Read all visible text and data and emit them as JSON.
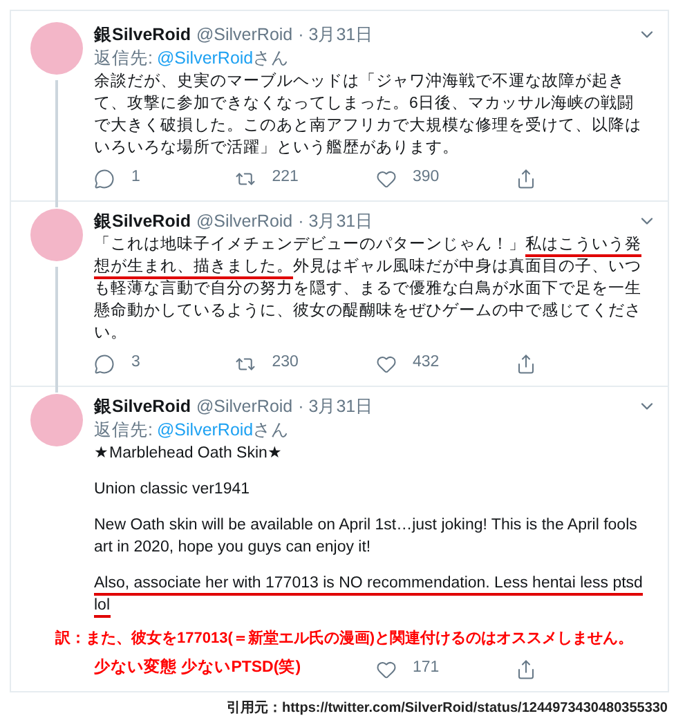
{
  "tweets": [
    {
      "author_name": "銀SilveRoid",
      "handle": "@SilverRoid",
      "date": "· 3月31日",
      "reply_to": {
        "label": "返信先:",
        "handle": "@SilverRoid",
        "suffix": "さん"
      },
      "connected_below": true,
      "body": [
        [
          {
            "text": "余談だが、史実のマーブルヘッドは「ジャワ沖海戦で不運な故障が起きて、攻撃に参加できなくなってしまった。6日後、マカッサル海峡の戦闘で大きく破損した。このあと南アフリカで大規模な修理を受けて、以降はいろいろな場所で活躍」という艦歴があります。",
            "underlined": false
          }
        ]
      ],
      "actions": [
        {
          "kind": "reply",
          "count": "1"
        },
        {
          "kind": "retweet",
          "count": "221"
        },
        {
          "kind": "like",
          "count": "390"
        },
        {
          "kind": "share"
        }
      ]
    },
    {
      "author_name": "銀SilveRoid",
      "handle": "@SilverRoid",
      "date": "· 3月31日",
      "connected_below": true,
      "body": [
        [
          {
            "text": "「これは地味子イメチェンデビューのパターンじゃん！」",
            "underlined": false
          },
          {
            "text": "私はこういう発想が生まれ、描きました。",
            "underlined": true
          },
          {
            "text": "外見はギャル風味だが中身は真面目の子、いつも軽薄な言動で自分の努力を隠す、まるで優雅な白鳥が水面下で足を一生懸命動かしているように、彼女の醍醐味をぜひゲームの中で感じてください。",
            "underlined": false
          }
        ]
      ],
      "actions": [
        {
          "kind": "reply",
          "count": "3"
        },
        {
          "kind": "retweet",
          "count": "230"
        },
        {
          "kind": "like",
          "count": "432"
        },
        {
          "kind": "share"
        }
      ]
    },
    {
      "author_name": "銀SilveRoid",
      "handle": "@SilverRoid",
      "date": "· 3月31日",
      "reply_to": {
        "label": "返信先:",
        "handle": "@SilverRoid",
        "suffix": "さん"
      },
      "connected_below": false,
      "body": [
        [
          {
            "text": "★Marblehead Oath Skin★",
            "underlined": false
          }
        ],
        [
          {
            "text": "Union classic ver1941",
            "underlined": false
          }
        ],
        [
          {
            "text": "New Oath skin will be available on April 1st…just joking! This is the April fools art in 2020, hope you guys can enjoy it!",
            "underlined": false
          }
        ],
        [
          {
            "text": "Also, associate her with 177013 is NO recommendation. Less hentai less ptsd lol",
            "underlined": true
          }
        ]
      ],
      "translation": [
        "訳：また、彼女を177013(＝新堂エル氏の漫画)と関連付けるのはオススメしません。",
        "少ない変態 少ないPTSD(笑)"
      ],
      "actions": [
        {
          "kind": "like",
          "count": "171"
        },
        {
          "kind": "share"
        }
      ]
    }
  ],
  "source": "引用元：https://twitter.com/SilverRoid/status/1244973430480355330"
}
